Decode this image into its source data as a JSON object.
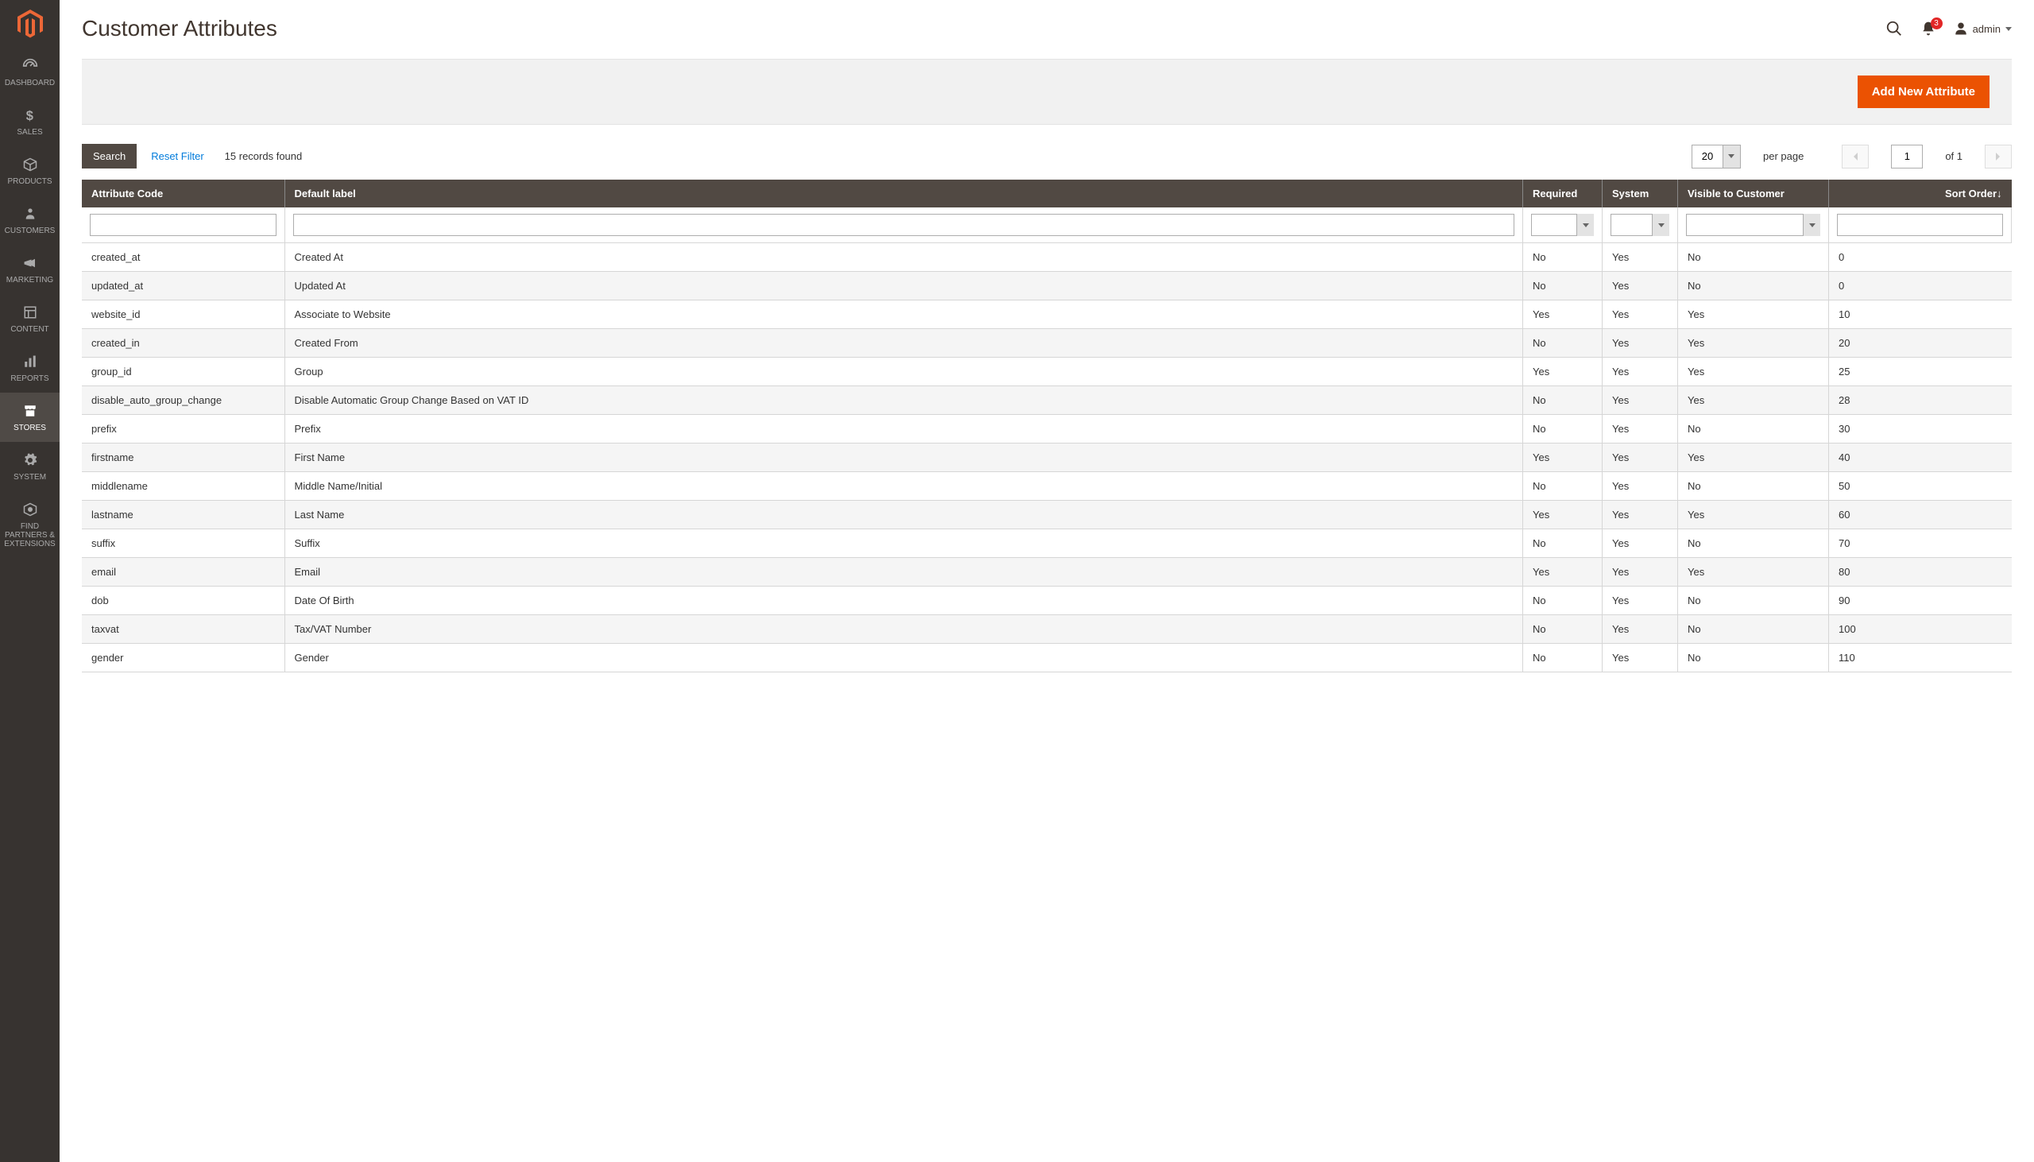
{
  "page": {
    "title": "Customer Attributes"
  },
  "header": {
    "notification_count": "3",
    "user_name": "admin"
  },
  "sidebar": {
    "items": [
      {
        "label": "DASHBOARD"
      },
      {
        "label": "SALES"
      },
      {
        "label": "PRODUCTS"
      },
      {
        "label": "CUSTOMERS"
      },
      {
        "label": "MARKETING"
      },
      {
        "label": "CONTENT"
      },
      {
        "label": "REPORTS"
      },
      {
        "label": "STORES"
      },
      {
        "label": "SYSTEM"
      },
      {
        "label": "FIND PARTNERS & EXTENSIONS"
      }
    ]
  },
  "actions": {
    "add_new": "Add New Attribute"
  },
  "toolbar": {
    "search": "Search",
    "reset": "Reset Filter",
    "records_found": "15 records found",
    "per_page_value": "20",
    "per_page_label": "per page",
    "page_value": "1",
    "of_label": "of 1"
  },
  "table": {
    "columns": {
      "code": "Attribute Code",
      "label": "Default label",
      "required": "Required",
      "system": "System",
      "visible": "Visible to Customer",
      "sort": "Sort Order"
    },
    "rows": [
      {
        "code": "created_at",
        "label": "Created At",
        "required": "No",
        "system": "Yes",
        "visible": "No",
        "sort": "0"
      },
      {
        "code": "updated_at",
        "label": "Updated At",
        "required": "No",
        "system": "Yes",
        "visible": "No",
        "sort": "0"
      },
      {
        "code": "website_id",
        "label": "Associate to Website",
        "required": "Yes",
        "system": "Yes",
        "visible": "Yes",
        "sort": "10"
      },
      {
        "code": "created_in",
        "label": "Created From",
        "required": "No",
        "system": "Yes",
        "visible": "Yes",
        "sort": "20"
      },
      {
        "code": "group_id",
        "label": "Group",
        "required": "Yes",
        "system": "Yes",
        "visible": "Yes",
        "sort": "25"
      },
      {
        "code": "disable_auto_group_change",
        "label": "Disable Automatic Group Change Based on VAT ID",
        "required": "No",
        "system": "Yes",
        "visible": "Yes",
        "sort": "28"
      },
      {
        "code": "prefix",
        "label": "Prefix",
        "required": "No",
        "system": "Yes",
        "visible": "No",
        "sort": "30"
      },
      {
        "code": "firstname",
        "label": "First Name",
        "required": "Yes",
        "system": "Yes",
        "visible": "Yes",
        "sort": "40"
      },
      {
        "code": "middlename",
        "label": "Middle Name/Initial",
        "required": "No",
        "system": "Yes",
        "visible": "No",
        "sort": "50"
      },
      {
        "code": "lastname",
        "label": "Last Name",
        "required": "Yes",
        "system": "Yes",
        "visible": "Yes",
        "sort": "60"
      },
      {
        "code": "suffix",
        "label": "Suffix",
        "required": "No",
        "system": "Yes",
        "visible": "No",
        "sort": "70"
      },
      {
        "code": "email",
        "label": "Email",
        "required": "Yes",
        "system": "Yes",
        "visible": "Yes",
        "sort": "80"
      },
      {
        "code": "dob",
        "label": "Date Of Birth",
        "required": "No",
        "system": "Yes",
        "visible": "No",
        "sort": "90"
      },
      {
        "code": "taxvat",
        "label": "Tax/VAT Number",
        "required": "No",
        "system": "Yes",
        "visible": "No",
        "sort": "100"
      },
      {
        "code": "gender",
        "label": "Gender",
        "required": "No",
        "system": "Yes",
        "visible": "No",
        "sort": "110"
      }
    ]
  }
}
